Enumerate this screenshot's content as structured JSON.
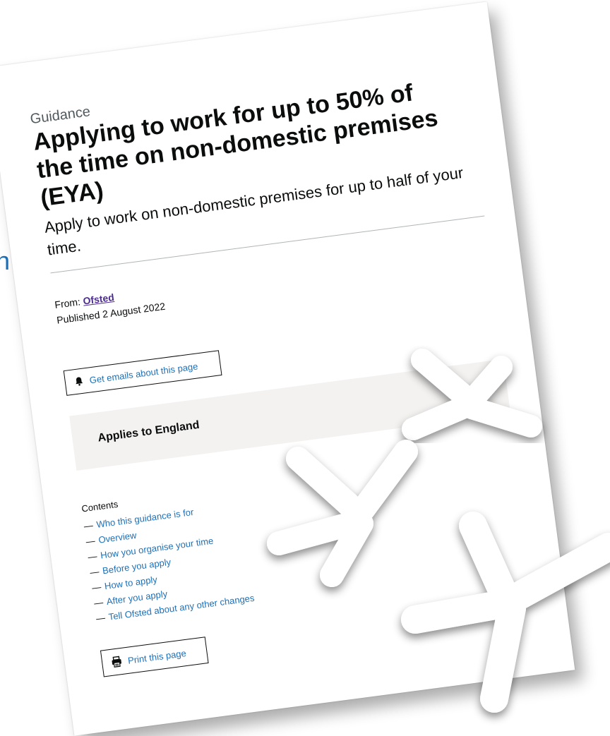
{
  "edge_glyph": "n",
  "page": {
    "caption": "Guidance",
    "title": "Applying to work for up to 50% of the time on non-domestic premises (EYA)",
    "lead": "Apply to work on non-domestic premises for up to half of your time.",
    "from_label": "From:",
    "from_org": "Ofsted",
    "published": "Published 2 August 2022",
    "email_button": "Get emails about this page",
    "applies_to": "Applies to England",
    "contents_label": "Contents",
    "contents_dash": "—",
    "contents": [
      "Who this guidance is for",
      "Overview",
      "How you organise your time",
      "Before you apply",
      "How to apply",
      "After you apply",
      "Tell Ofsted about any other changes"
    ],
    "print_button": "Print this page"
  },
  "icons": {
    "email": "bell-icon",
    "print": "printer-icon",
    "overlay": "sparkle-icon"
  },
  "colors": {
    "link": "#1d70b8",
    "visited_link": "#4c2c92",
    "text": "#0b0c0c",
    "secondary_text": "#505a5f",
    "panel": "#f3f2f1",
    "border": "#b1b4b6"
  }
}
